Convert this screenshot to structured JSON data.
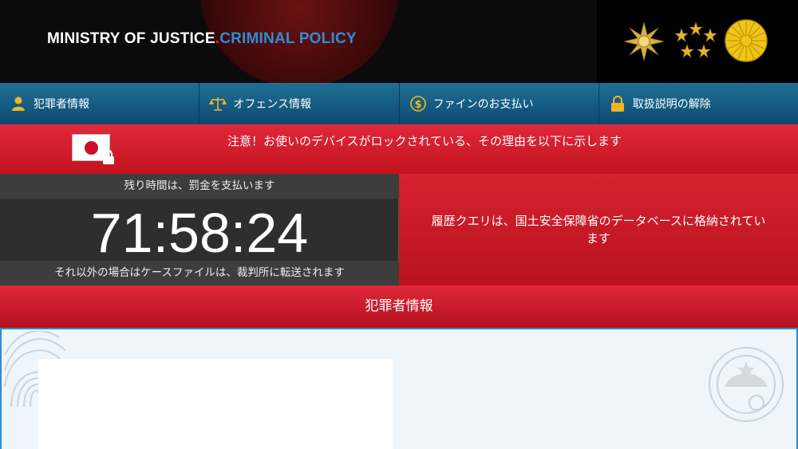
{
  "header": {
    "logo_main": "MINISTRY OF JUSTICE",
    "logo_dot": ".",
    "logo_sub": "CRIMINAL POLICY",
    "emblems": [
      "police-emblem-icon",
      "five-stars-icon",
      "chrysanthemum-seal-icon"
    ]
  },
  "nav": {
    "items": [
      {
        "label": "犯罪者情報",
        "icon": "user-icon"
      },
      {
        "label": "オフェンス情報",
        "icon": "scales-icon"
      },
      {
        "label": "ファインのお支払い",
        "icon": "dollar-icon"
      },
      {
        "label": "取扱説明の解除",
        "icon": "lock-icon"
      }
    ]
  },
  "alert": {
    "text": "注意！お使いのデバイスがロックされている、その理由を以下に示します",
    "icon": "japan-flag-lock-icon"
  },
  "timer": {
    "top_text": "残り時間は、罰金を支払います",
    "value": "71:58:24",
    "bottom_text": "それ以外の場合はケースファイルは、裁判所に転送されます"
  },
  "history": {
    "text": "履歴クエリは、国土安全保障省のデータベースに格納されています"
  },
  "section": {
    "title": "犯罪者情報"
  },
  "colors": {
    "accent_red": "#d6222f",
    "nav_blue": "#1f6f97",
    "logo_blue": "#2c8fd8",
    "content_border": "#2a8cd8"
  }
}
